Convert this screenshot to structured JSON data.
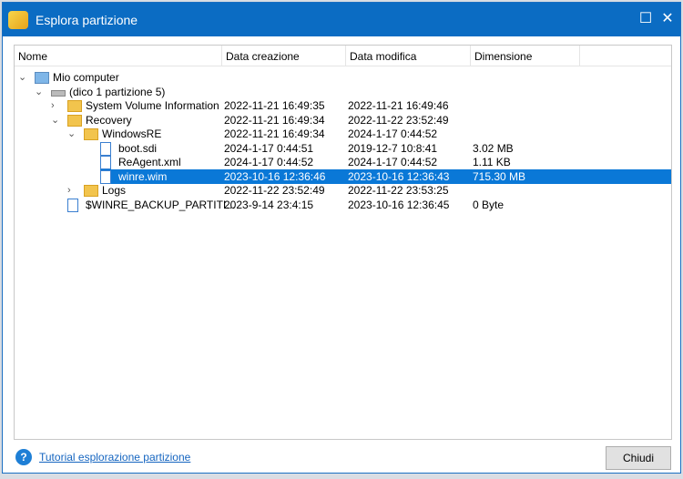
{
  "window": {
    "title": "Esplora partizione"
  },
  "columns": [
    "Nome",
    "Data creazione",
    "Data modifica",
    "Dimensione"
  ],
  "rows": [
    {
      "name": "Mio computer",
      "created": "",
      "modified": "",
      "size": "",
      "icon": "computer-icon",
      "level": 0,
      "expander": "expanded"
    },
    {
      "name": "(dico 1 partizione 5)",
      "created": "",
      "modified": "",
      "size": "",
      "icon": "drive-icon",
      "level": 1,
      "expander": "expanded"
    },
    {
      "name": "System Volume Information",
      "created": "2022-11-21 16:49:35",
      "modified": "2022-11-21 16:49:46",
      "size": "",
      "icon": "folder-icon",
      "level": 2,
      "expander": "collapsed"
    },
    {
      "name": "Recovery",
      "created": "2022-11-21 16:49:34",
      "modified": "2022-11-22 23:52:49",
      "size": "",
      "icon": "folder-icon",
      "level": 2,
      "expander": "expanded"
    },
    {
      "name": "WindowsRE",
      "created": "2022-11-21 16:49:34",
      "modified": "2024-1-17 0:44:52",
      "size": "",
      "icon": "folder-icon",
      "level": 3,
      "expander": "expanded"
    },
    {
      "name": "boot.sdi",
      "created": "2024-1-17 0:44:51",
      "modified": "2019-12-7 10:8:41",
      "size": "3.02 MB",
      "icon": "file-icon",
      "level": 4,
      "expander": ""
    },
    {
      "name": "ReAgent.xml",
      "created": "2024-1-17 0:44:52",
      "modified": "2024-1-17 0:44:52",
      "size": "1.11 KB",
      "icon": "file-icon",
      "level": 4,
      "expander": ""
    },
    {
      "name": "winre.wim",
      "created": "2023-10-16 12:36:46",
      "modified": "2023-10-16 12:36:43",
      "size": "715.30 MB",
      "icon": "file-icon",
      "level": 4,
      "expander": "",
      "selected": true
    },
    {
      "name": "Logs",
      "created": "2022-11-22 23:52:49",
      "modified": "2022-11-22 23:53:25",
      "size": "",
      "icon": "folder-icon",
      "level": 3,
      "expander": "collapsed"
    },
    {
      "name": "$WINRE_BACKUP_PARTITI...",
      "created": "2023-9-14 23:4:15",
      "modified": "2023-10-16 12:36:45",
      "size": "0 Byte",
      "icon": "file-icon",
      "level": 2,
      "expander": ""
    }
  ],
  "footer": {
    "help_link": "Tutorial esplorazione partizione",
    "close_button": "Chiudi"
  }
}
